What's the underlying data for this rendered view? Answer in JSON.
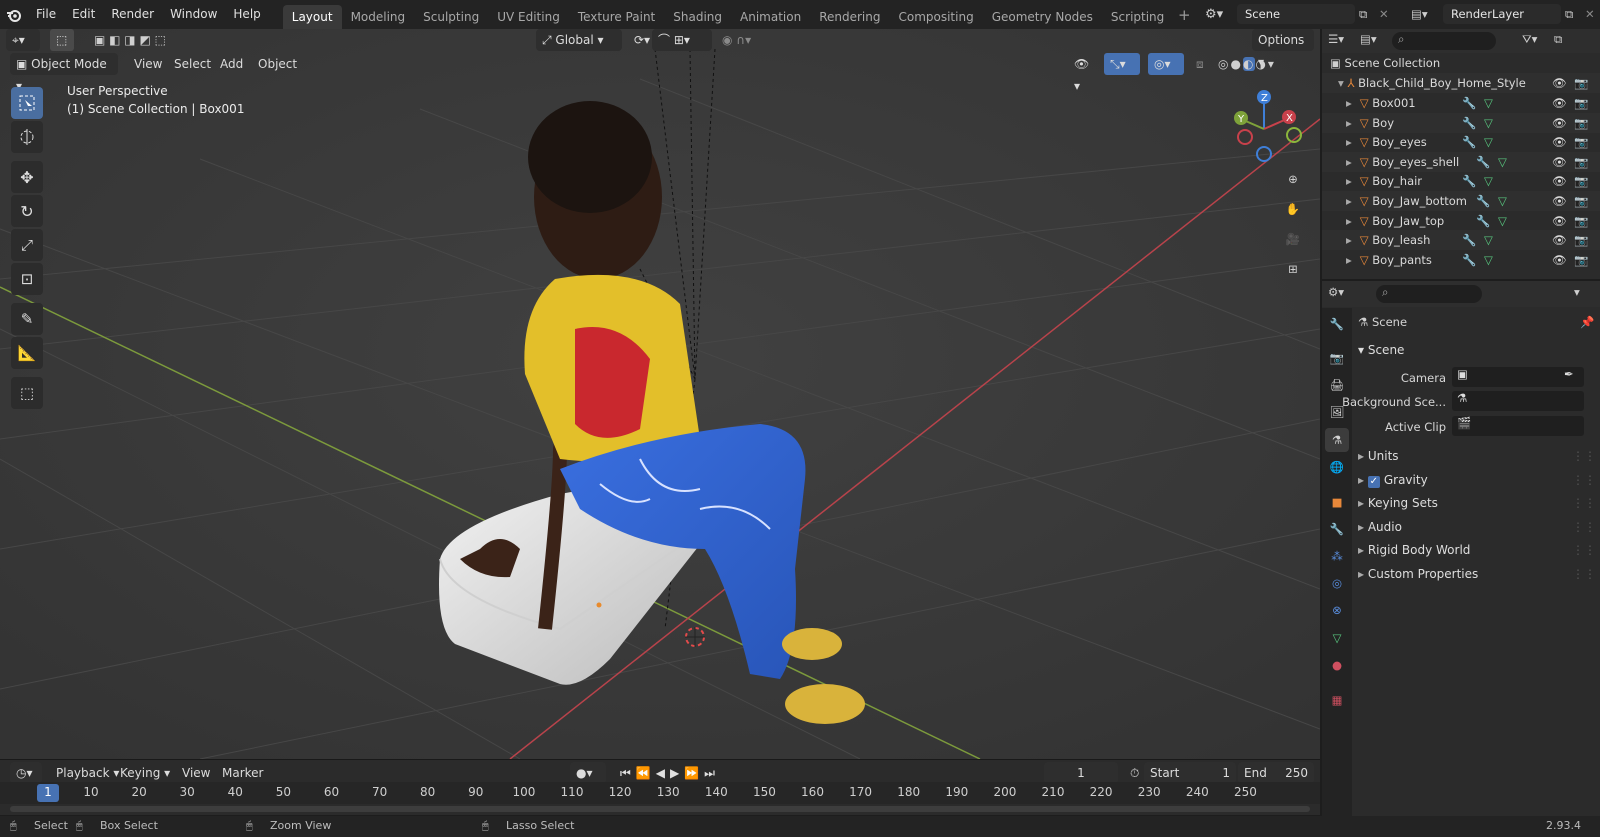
{
  "menu": {
    "items": [
      "File",
      "Edit",
      "Render",
      "Window",
      "Help"
    ]
  },
  "workspaces": {
    "tabs": [
      "Layout",
      "Modeling",
      "Sculpting",
      "UV Editing",
      "Texture Paint",
      "Shading",
      "Animation",
      "Rendering",
      "Compositing",
      "Geometry Nodes",
      "Scripting"
    ],
    "active": "Layout"
  },
  "scene_field": "Scene",
  "view_layer_field": "RenderLayer",
  "viewport": {
    "mode": "Object Mode",
    "menus": [
      "View",
      "Select",
      "Add",
      "Object"
    ],
    "transform_orientation": "Global",
    "options_label": "Options",
    "info_line1": "User Perspective",
    "info_line2": "(1) Scene Collection | Box001",
    "gizmo_labels": {
      "x": "X",
      "y": "Y",
      "z": "Z"
    }
  },
  "timeline": {
    "menus": [
      "Playback",
      "Keying",
      "View",
      "Marker"
    ],
    "current_frame": "1",
    "start_label": "Start",
    "start": "1",
    "end_label": "End",
    "end": "250",
    "ruler": [
      "1",
      "10",
      "20",
      "30",
      "40",
      "50",
      "60",
      "70",
      "80",
      "90",
      "100",
      "110",
      "120",
      "130",
      "140",
      "150",
      "160",
      "170",
      "180",
      "190",
      "200",
      "210",
      "220",
      "230",
      "240",
      "250"
    ]
  },
  "status": {
    "select": "Select",
    "box_select": "Box Select",
    "zoom_view": "Zoom View",
    "lasso_select": "Lasso Select",
    "version": "2.93.4"
  },
  "outliner": {
    "root": "Scene Collection",
    "collection": "Black_Child_Boy_Home_Style",
    "objects": [
      "Box001",
      "Boy",
      "Boy_eyes",
      "Boy_eyes_shell",
      "Boy_hair",
      "Boy_Jaw_bottom",
      "Boy_Jaw_top",
      "Boy_leash",
      "Boy_pants"
    ]
  },
  "properties": {
    "context_title": "Scene",
    "panel_scene": "Scene",
    "camera_label": "Camera",
    "background_label": "Background Sce...",
    "active_clip_label": "Active Clip",
    "panels": [
      "Units",
      "Gravity",
      "Keying Sets",
      "Audio",
      "Rigid Body World",
      "Custom Properties"
    ],
    "gravity_checked": true
  },
  "colors": {
    "accent": "#4772b3",
    "x_axis": "#c8414b",
    "y_axis": "#7ea23a",
    "z_axis": "#3f7fd8",
    "object_orange": "#e8883a"
  }
}
